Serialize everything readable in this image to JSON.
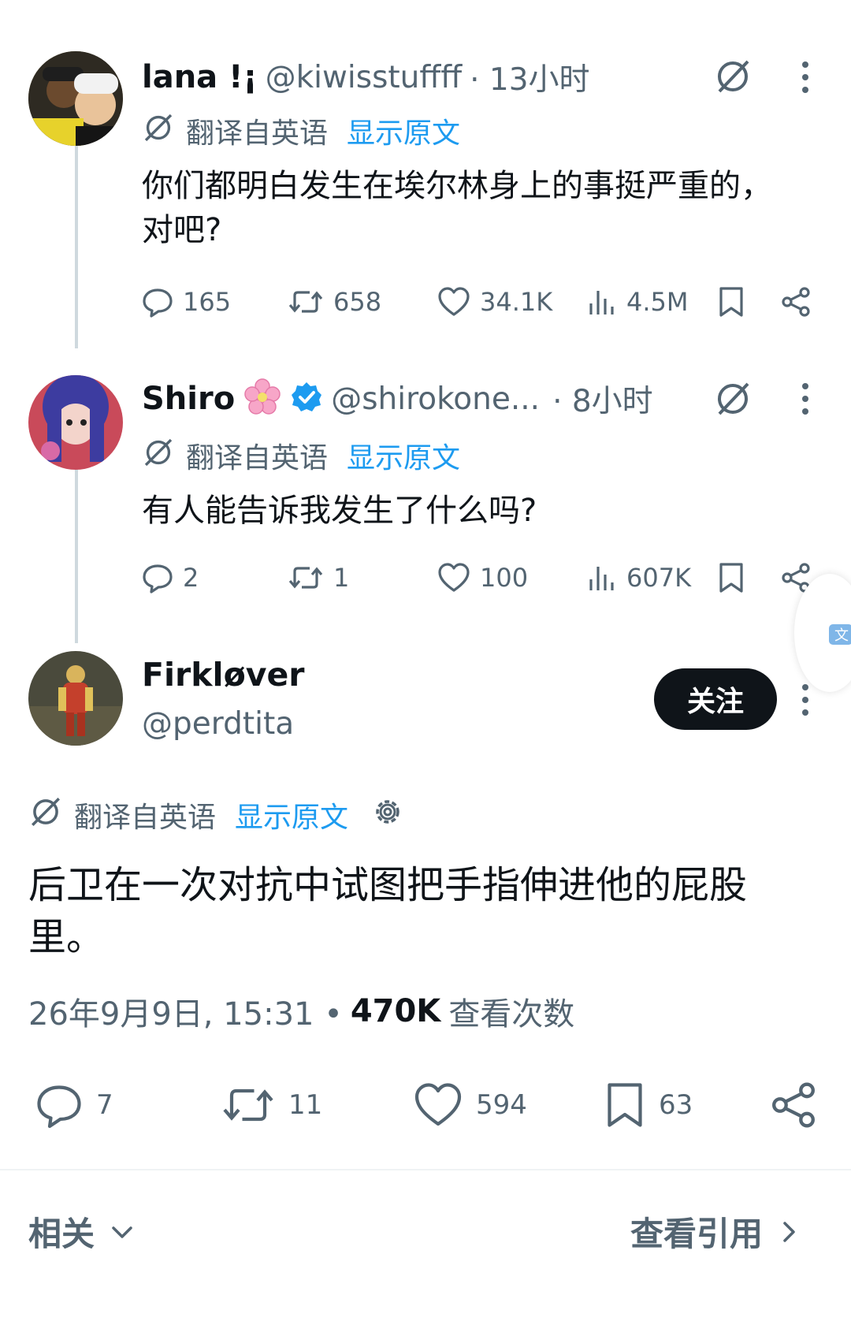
{
  "posts": [
    {
      "name": "lana !¡",
      "handle": "@kiwisstuffff",
      "time": "· 13小时",
      "translate_label": "翻译自英语",
      "show_original": "显示原文",
      "text": "你们都明白发生在埃尔林身上的事挺严重的，对吧?",
      "replies": "165",
      "retweets": "658",
      "likes": "34.1K",
      "views": "4.5M"
    },
    {
      "name": "Shiro",
      "handle": "@shirokone...",
      "time": "· 8小时",
      "translate_label": "翻译自英语",
      "show_original": "显示原文",
      "text": "有人能告诉我发生了什么吗?",
      "replies": "2",
      "retweets": "1",
      "likes": "100",
      "views": "607K"
    }
  ],
  "main_post": {
    "name": "Firkløver",
    "handle": "@perdtita",
    "follow_label": "关注",
    "translate_label": "翻译自英语",
    "show_original": "显示原文",
    "text": "后卫在一次对抗中试图把手指伸进他的屁股里。",
    "timestamp": "26年9月9日, 15:31 •",
    "views_count": "470K",
    "views_label": "查看次数",
    "replies": "7",
    "retweets": "11",
    "likes": "594",
    "bookmarks": "63"
  },
  "footer": {
    "related": "相关",
    "view_quotes": "查看引用"
  },
  "colors": {
    "accent": "#1d9bf0",
    "text": "#0f1419",
    "muted": "#536471"
  }
}
